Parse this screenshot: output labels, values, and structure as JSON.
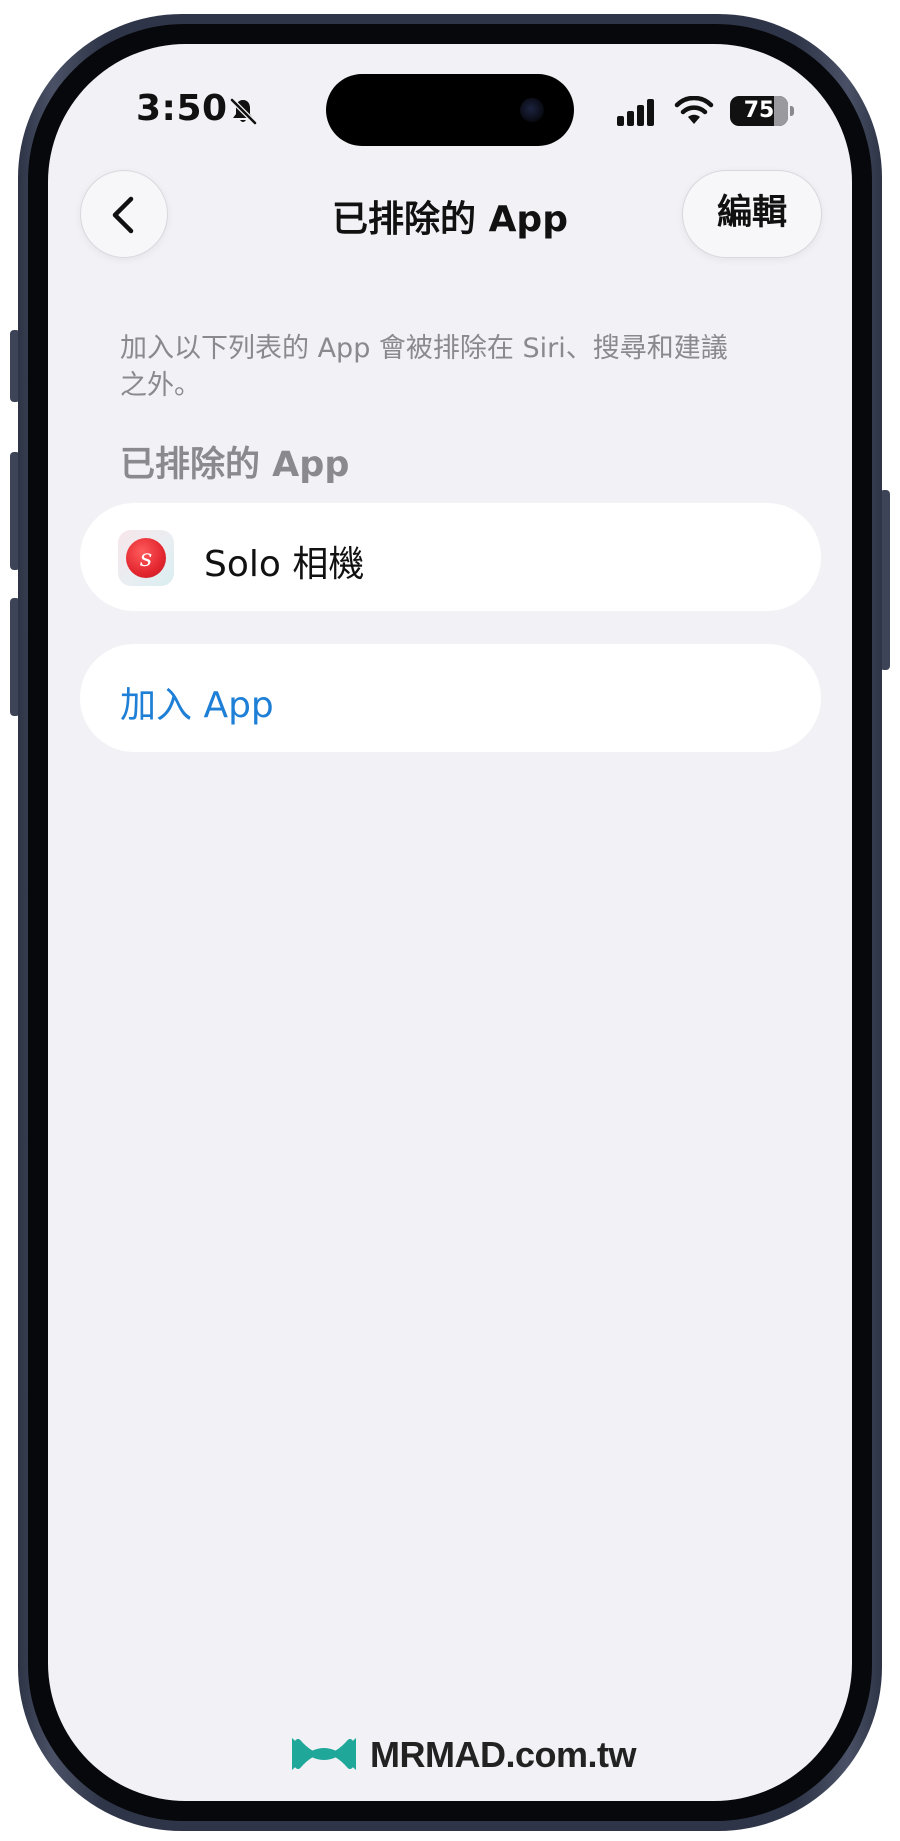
{
  "status_bar": {
    "time": "3:50",
    "battery": "75",
    "icons": [
      "bell-slash-icon",
      "cellular-signal-icon",
      "wifi-icon",
      "battery-icon"
    ]
  },
  "nav": {
    "title": "已排除的 App",
    "back_icon": "chevron-left-icon",
    "edit_label": "編輯"
  },
  "content": {
    "description": "加入以下列表的 App 會被排除在 Siri、搜尋和建議之外。",
    "section_header": "已排除的 App",
    "excluded_apps": [
      {
        "name": "Solo 相機",
        "icon": "solo-camera-app-icon",
        "icon_letter": "s"
      }
    ],
    "add_app_label": "加入 App"
  },
  "watermark": {
    "text": "MRMAD.com.tw"
  },
  "colors": {
    "background": "#f2f2f6",
    "card": "#ffffff",
    "accent": "#1e7fd6",
    "secondary_text": "#8a8a8e",
    "watermark_logo": "#1fa79a"
  }
}
